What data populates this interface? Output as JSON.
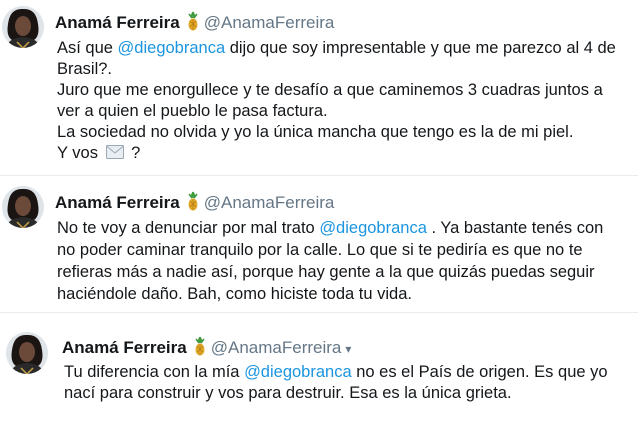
{
  "tweets": [
    {
      "name": "Anamá Ferreira",
      "handle": "@AnamaFerreira",
      "lines": [
        {
          "a": "Así que ",
          "m": "@diegobranca",
          "b": " dijo que soy impresentable y que me parezco al 4 de"
        },
        {
          "a": "Brasil?."
        },
        {
          "a": "Juro que me enorgullece y te desafío a que caminemos 3 cuadras juntos a"
        },
        {
          "a": "ver a quien el pueblo le pasa factura."
        },
        {
          "a": "La sociedad no olvida y yo la única mancha que tengo es la de mi piel."
        },
        {
          "a": "Y vos ",
          "b": " ?"
        }
      ]
    },
    {
      "name": "Anamá Ferreira",
      "handle": "@AnamaFerreira",
      "lines": [
        {
          "a": "No te voy a denunciar por mal trato ",
          "m": "@diegobranca",
          "b": "  . Ya bastante tenés con"
        },
        {
          "a": "no poder caminar tranquilo por la calle. Lo que si te pediría es que no te"
        },
        {
          "a": "refieras más a nadie así, porque hay gente a la que quizás puedas seguir"
        },
        {
          "a": "haciéndole daño. Bah, como hiciste toda tu vida."
        }
      ]
    },
    {
      "name": "Anamá Ferreira",
      "handle": "@AnamaFerreira",
      "caret": "▾",
      "lines": [
        {
          "a": "Tu diferencia con la mía ",
          "m": "@diegobranca",
          "b": " no es el País de origen. Es que yo"
        },
        {
          "a": "nací para construir y vos para destruir. Esa es la única grieta."
        }
      ]
    }
  ]
}
